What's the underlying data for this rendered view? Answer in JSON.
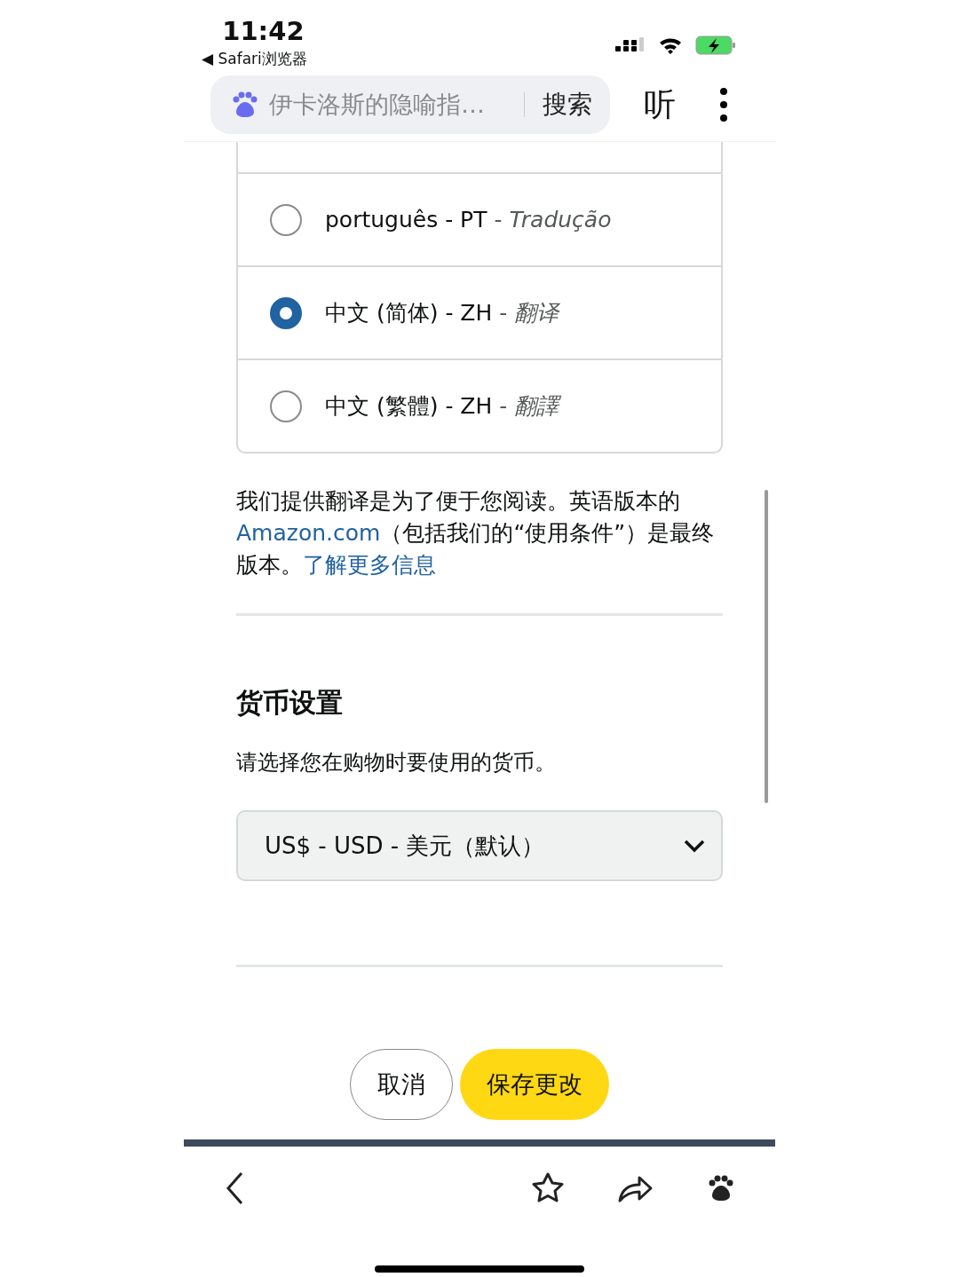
{
  "status_bar": {
    "time": "11:42",
    "back_app": "◀ Safari浏览器"
  },
  "address_bar": {
    "query": "伊卡洛斯的隐喻指…",
    "search_button": "搜索",
    "listen_button": "听"
  },
  "language_options": [
    {
      "label": "português - PT",
      "note": "- *Tradução*",
      "selected": false
    },
    {
      "label": "中文 (简体) - ZH",
      "note": "- *翻译*",
      "selected": true
    },
    {
      "label": "中文 (繁體) - ZH",
      "note": "- *翻譯*",
      "selected": false
    }
  ],
  "notice": [
    {
      "kind": "text",
      "text": "我们提供翻译是为了便于您阅读。英语版本的"
    },
    {
      "kind": "link",
      "text": "Amazon.com"
    },
    {
      "kind": "text",
      "text": "（包括我们的“使用条件”）是最终版本。"
    },
    {
      "kind": "link",
      "text": "了解更多信息"
    }
  ],
  "currency": {
    "heading": "货币设置",
    "description": "请选择您在购物时要使用的货币。",
    "value": "US$ - USD - 美元（默认）"
  },
  "buttons": [
    {
      "kind": "secondary",
      "label": "取消"
    },
    {
      "kind": "primary",
      "label": "保存更改"
    }
  ]
}
